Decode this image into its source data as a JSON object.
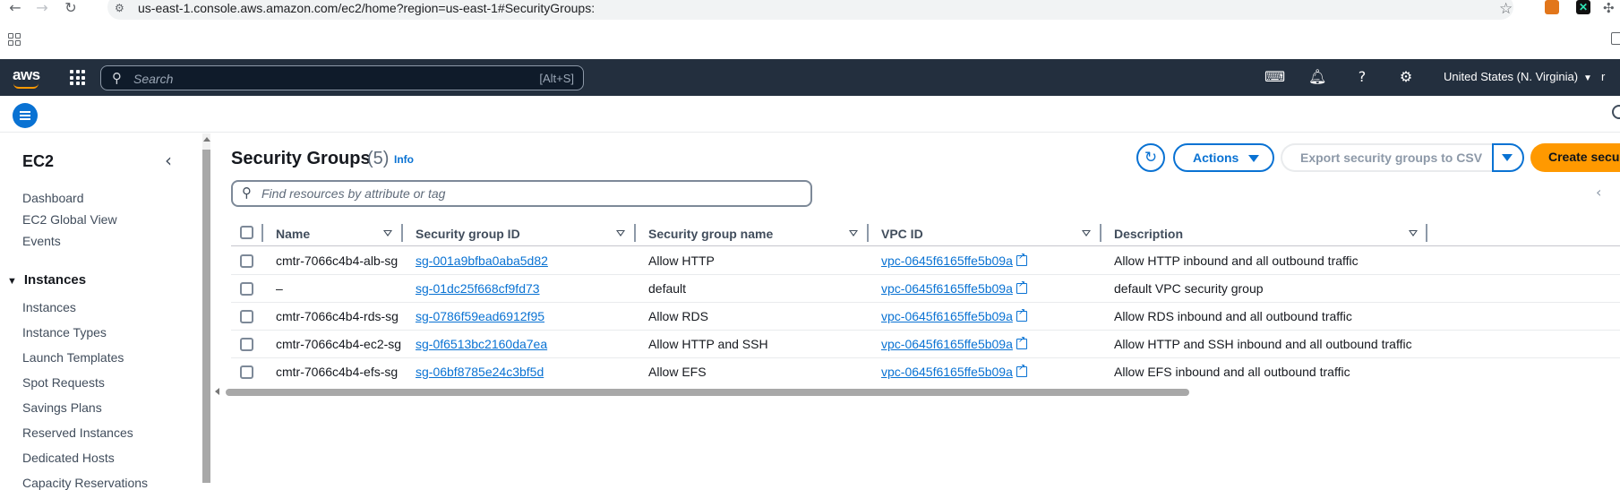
{
  "browser": {
    "url": "us-east-1.console.aws.amazon.com/ec2/home?region=us-east-1#SecurityGroups:"
  },
  "topnav": {
    "logo": "aws",
    "search_placeholder": "Search",
    "search_shortcut": "[Alt+S]",
    "region": "United States (N. Virginia)",
    "cut_text": "r"
  },
  "sidebar": {
    "title": "EC2",
    "links": [
      "Dashboard",
      "EC2 Global View",
      "Events"
    ],
    "section": "Instances",
    "section_items": [
      "Instances",
      "Instance Types",
      "Launch Templates",
      "Spot Requests",
      "Savings Plans",
      "Reserved Instances",
      "Dedicated Hosts",
      "Capacity Reservations"
    ]
  },
  "main": {
    "title": "Security Groups",
    "count": "(5)",
    "info": "Info",
    "actions_label": "Actions",
    "export_label": "Export security groups to CSV",
    "create_label": "Create security group",
    "filter_placeholder": "Find resources by attribute or tag"
  },
  "table": {
    "columns": [
      "Name",
      "Security group ID",
      "Security group name",
      "VPC ID",
      "Description"
    ],
    "rows": [
      {
        "name": "cmtr-7066c4b4-alb-sg",
        "sg_id": "sg-001a9bfba0aba5d82",
        "sg_name": "Allow HTTP",
        "vpc_id": "vpc-0645f6165ffe5b09a",
        "description": "Allow HTTP inbound and all outbound traffic"
      },
      {
        "name": "–",
        "sg_id": "sg-01dc25f668cf9fd73",
        "sg_name": "default",
        "vpc_id": "vpc-0645f6165ffe5b09a",
        "description": "default VPC security group"
      },
      {
        "name": "cmtr-7066c4b4-rds-sg",
        "sg_id": "sg-0786f59ead6912f95",
        "sg_name": "Allow RDS",
        "vpc_id": "vpc-0645f6165ffe5b09a",
        "description": "Allow RDS inbound and all outbound traffic"
      },
      {
        "name": "cmtr-7066c4b4-ec2-sg",
        "sg_id": "sg-0f6513bc2160da7ea",
        "sg_name": "Allow HTTP and SSH",
        "vpc_id": "vpc-0645f6165ffe5b09a",
        "description": "Allow HTTP and SSH inbound and all outbound traffic"
      },
      {
        "name": "cmtr-7066c4b4-efs-sg",
        "sg_id": "sg-06bf8785e24c3bf5d",
        "sg_name": "Allow EFS",
        "vpc_id": "vpc-0645f6165ffe5b09a",
        "description": "Allow EFS inbound and all outbound traffic"
      }
    ]
  },
  "colors": {
    "aws_nav": "#232f3e",
    "link_blue": "#0972d3",
    "primary_orange": "#ff9900"
  }
}
